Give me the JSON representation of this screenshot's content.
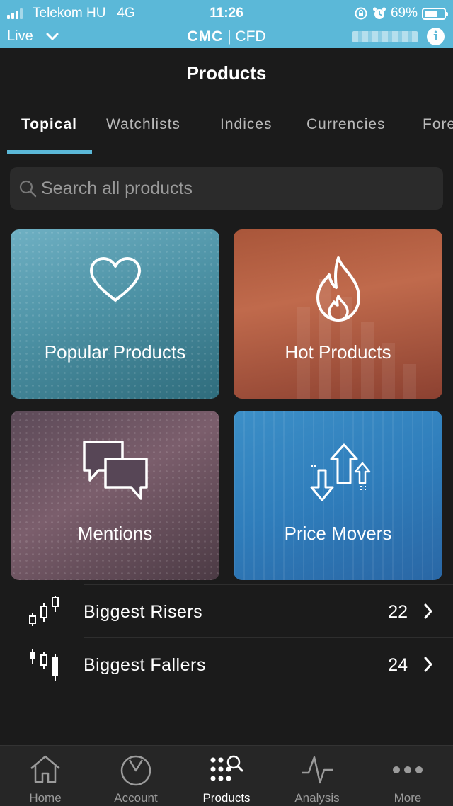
{
  "status_bar": {
    "carrier": "Telekom HU",
    "network": "4G",
    "time": "11:26",
    "battery": "69%",
    "battery_level": 0.69
  },
  "app_bar": {
    "mode": "Live",
    "brand_logo": "CMC",
    "brand_suffix": "| CFD"
  },
  "header": {
    "title": "Products"
  },
  "tabs": [
    {
      "label": "Topical",
      "active": true
    },
    {
      "label": "Watchlists",
      "active": false
    },
    {
      "label": "Indices",
      "active": false
    },
    {
      "label": "Currencies",
      "active": false
    },
    {
      "label": "Fore",
      "active": false
    }
  ],
  "search": {
    "placeholder": "Search all products"
  },
  "tiles": [
    {
      "label": "Popular Products",
      "icon": "heart-icon"
    },
    {
      "label": "Hot Products",
      "icon": "flame-icon"
    },
    {
      "label": "Mentions",
      "icon": "speech-bubbles-icon"
    },
    {
      "label": "Price Movers",
      "icon": "up-down-arrows-icon"
    }
  ],
  "lists": [
    {
      "label": "Biggest Risers",
      "count": "22",
      "icon": "candlestick-up-icon"
    },
    {
      "label": "Biggest Fallers",
      "count": "24",
      "icon": "candlestick-down-icon"
    }
  ],
  "bottom_nav": [
    {
      "label": "Home",
      "icon": "home-icon",
      "active": false
    },
    {
      "label": "Account",
      "icon": "account-dial-icon",
      "active": false
    },
    {
      "label": "Products",
      "icon": "products-search-icon",
      "active": true
    },
    {
      "label": "Analysis",
      "icon": "pulse-icon",
      "active": false
    },
    {
      "label": "More",
      "icon": "more-dots-icon",
      "active": false
    }
  ],
  "colors": {
    "accent": "#5bb8d8",
    "background": "#1b1b1b",
    "nav_background": "#262626"
  }
}
